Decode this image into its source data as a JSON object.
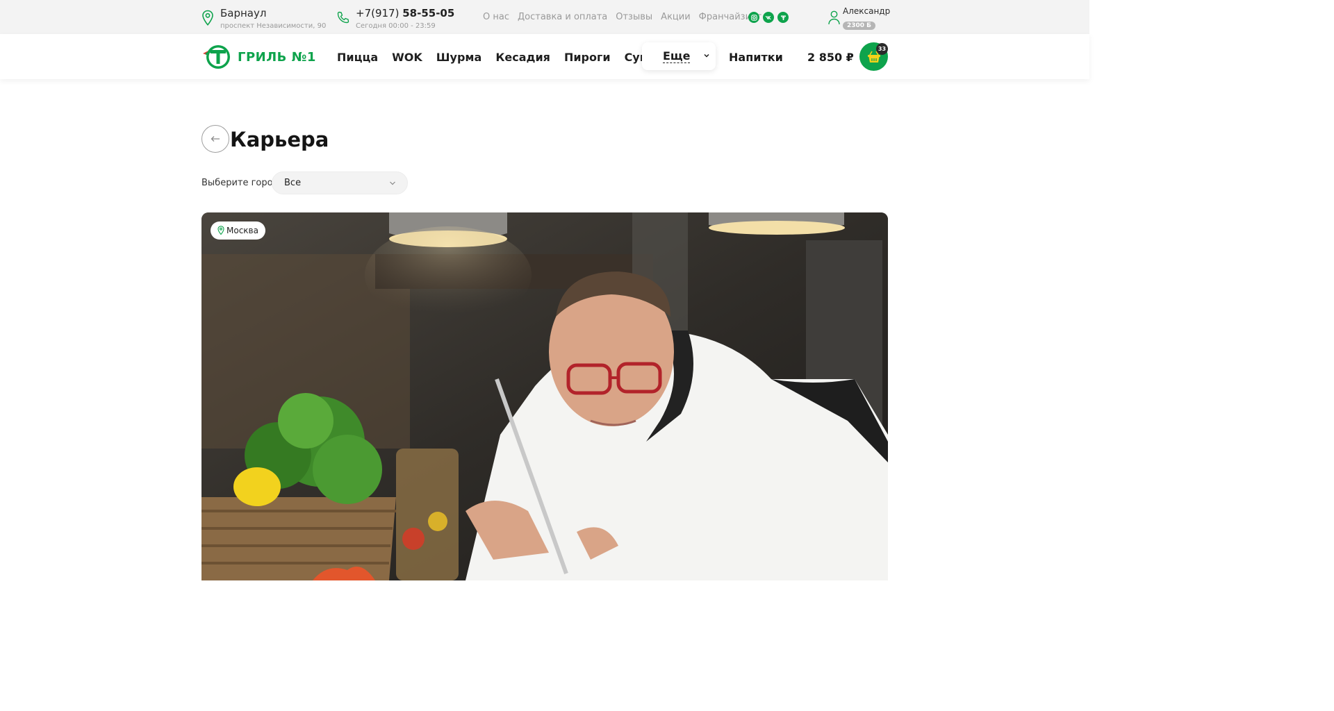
{
  "topbar": {
    "city": "Барнаул",
    "address": "проспект Независимости, 90",
    "phone_prefix": "+7(917)",
    "phone_main": "58-55-05",
    "hours": "Сегодня 00:00 - 23:59",
    "links": [
      "О нас",
      "Доставка и оплата",
      "Отзывы",
      "Акции",
      "Франчайзинг"
    ],
    "socials": [
      "instagram-icon",
      "vk-icon",
      "tiktok-icon"
    ],
    "user_name": "Александр",
    "user_bonus": "2300 Б"
  },
  "nav": {
    "logo_text": "ГРИЛЬ №1",
    "items": [
      "Пицца",
      "WOK",
      "Шурма",
      "Кесадия",
      "Пироги",
      "Супы"
    ],
    "more_label": "Еще",
    "drinks_label": "Напитки",
    "cart_total": "2 850 ₽",
    "cart_count": "33"
  },
  "content": {
    "title": "Карьера",
    "city_filter_label": "Выберите город",
    "city_filter_value": "Все",
    "hero_tag": "Москва"
  },
  "colors": {
    "brand_green": "#0ea34c",
    "topbar_bg": "#f3f3f3",
    "muted_text": "#9a9a9a"
  }
}
